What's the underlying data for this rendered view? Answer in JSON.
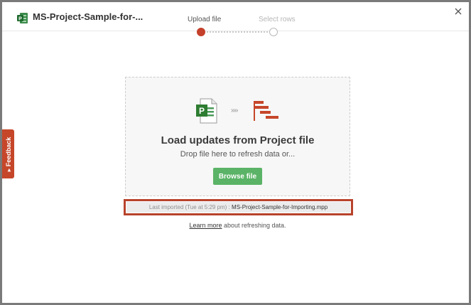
{
  "header": {
    "file_title": "MS-Project-Sample-for-...",
    "close_symbol": "×"
  },
  "steps": [
    {
      "label": "Upload file",
      "active": true
    },
    {
      "label": "Select rows",
      "active": false
    }
  ],
  "feedback_tab": {
    "label": "Feedback",
    "icon": "megaphone-icon"
  },
  "drop_zone": {
    "icons": [
      "ms-project-file-icon",
      "arrows-icon",
      "gantt-chart-icon"
    ],
    "arrows_text": "››››",
    "heading": "Load updates from Project file",
    "subtext": "Drop file here to refresh data or...",
    "browse_label": "Browse file"
  },
  "last_imported": {
    "prefix": "Last imported (Tue at 5:29 pm) :",
    "filename": "MS-Project-Sample-for-Importing.mpp"
  },
  "learn_more": {
    "link_text": "Learn more",
    "suffix": " about refreshing data."
  },
  "colors": {
    "accent_red": "#c4402a",
    "button_green": "#5ab366",
    "project_green": "#2e7d32",
    "highlight_border": "#b8432c"
  }
}
